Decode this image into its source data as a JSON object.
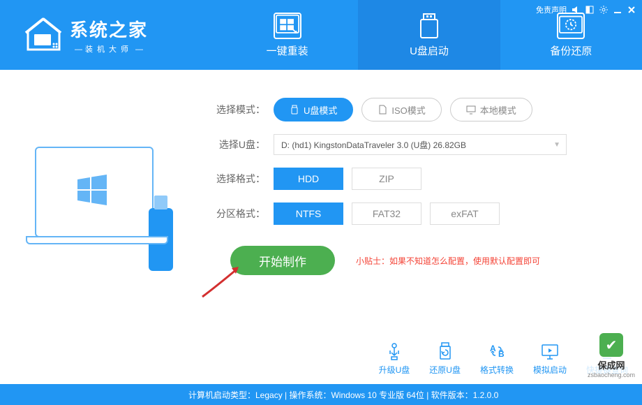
{
  "header": {
    "logo_title": "系统之家",
    "logo_subtitle": "装机大师",
    "disclaimer": "免责声明"
  },
  "tabs": [
    {
      "label": "一键重装",
      "active": false
    },
    {
      "label": "U盘启动",
      "active": true
    },
    {
      "label": "备份还原",
      "active": false
    }
  ],
  "form": {
    "mode_label": "选择模式：",
    "modes": [
      {
        "label": "U盘模式",
        "active": true
      },
      {
        "label": "ISO模式",
        "active": false
      },
      {
        "label": "本地模式",
        "active": false
      }
    ],
    "udisk_label": "选择U盘：",
    "udisk_value": "D: (hd1) KingstonDataTraveler 3.0 (U盘) 26.82GB",
    "format_label": "选择格式：",
    "formats": [
      {
        "label": "HDD",
        "active": true
      },
      {
        "label": "ZIP",
        "active": false
      }
    ],
    "partition_label": "分区格式：",
    "partitions": [
      {
        "label": "NTFS",
        "active": true
      },
      {
        "label": "FAT32",
        "active": false
      },
      {
        "label": "exFAT",
        "active": false
      }
    ],
    "start_button": "开始制作",
    "tip": "小贴士：如果不知道怎么配置，使用默认配置即可"
  },
  "bottom_actions": [
    {
      "label": "升级U盘"
    },
    {
      "label": "还原U盘"
    },
    {
      "label": "格式转换"
    },
    {
      "label": "模拟启动"
    },
    {
      "label": "快捷键查询"
    }
  ],
  "status": "计算机启动类型：Legacy | 操作系统：Windows 10 专业版 64位 | 软件版本：1.2.0.0",
  "watermark": {
    "name": "保成网",
    "url": "zsbaocheng.com"
  }
}
